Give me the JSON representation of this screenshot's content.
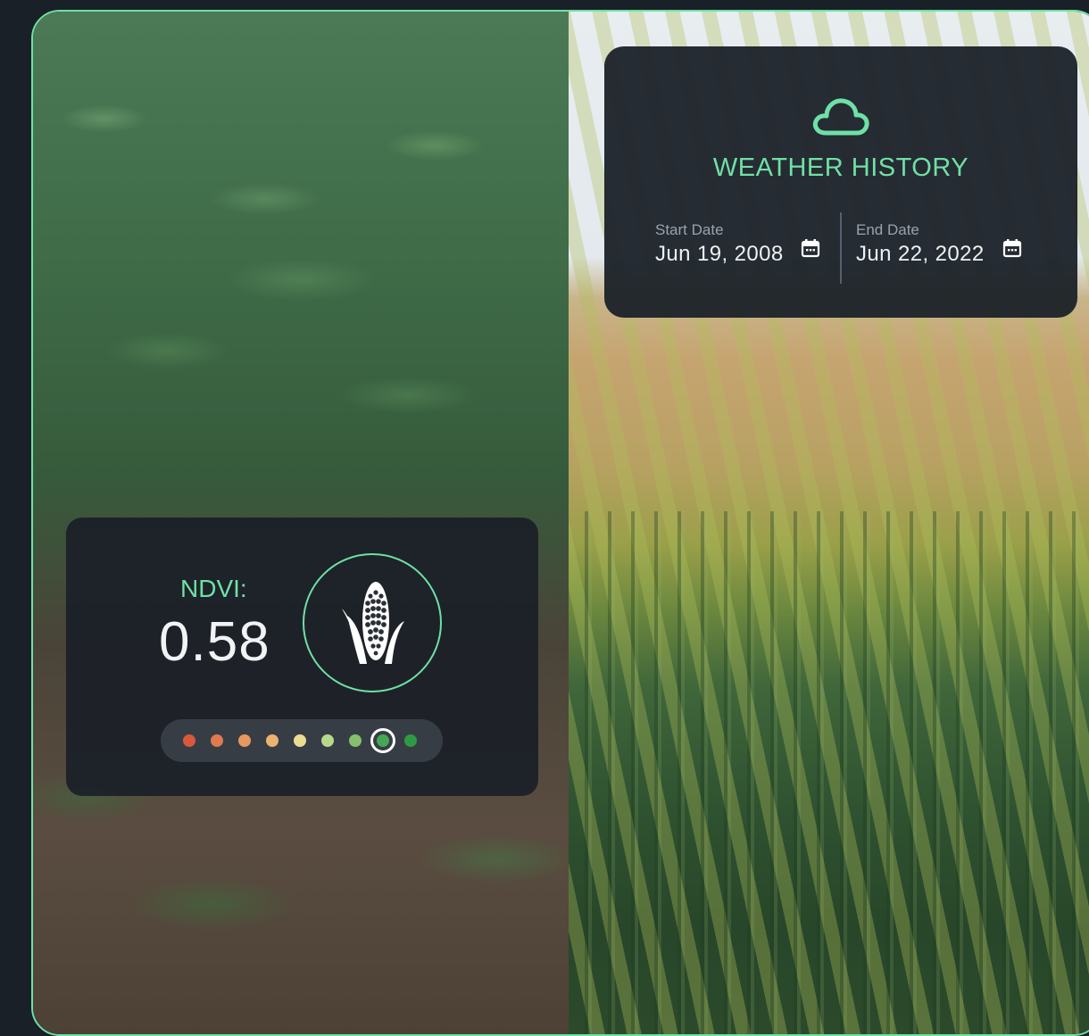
{
  "colors": {
    "accent": "#6fe0a6",
    "card_background": "#1a2027",
    "text_primary": "#eef1f4",
    "text_secondary": "#9aa3ad"
  },
  "weather": {
    "icon": "cloud-icon",
    "title": "WEATHER HISTORY",
    "start": {
      "label": "Start Date",
      "value": "Jun 19, 2008",
      "icon": "calendar-icon"
    },
    "end": {
      "label": "End Date",
      "value": "Jun 22, 2022",
      "icon": "calendar-icon"
    }
  },
  "ndvi": {
    "label": "NDVI:",
    "value": "0.58",
    "crop_icon": "corn-icon",
    "scale": {
      "colors": [
        "#d9583a",
        "#e07a4e",
        "#e7985e",
        "#eab36f",
        "#ecdc93",
        "#b8d98a",
        "#87c06d",
        "#44a852",
        "#2f9a45"
      ],
      "selected_index": 7
    }
  }
}
